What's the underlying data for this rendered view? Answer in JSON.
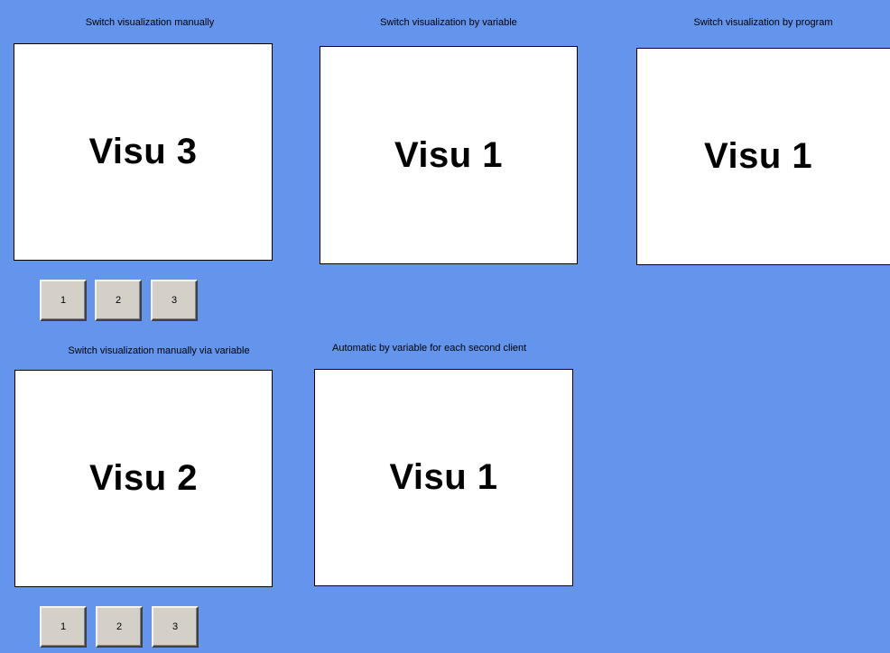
{
  "colors": {
    "background": "#6495ed",
    "frame": "#ffffff",
    "button": "#d4d0c8"
  },
  "panels": {
    "manual": {
      "caption": "Switch visualization manually",
      "content": "Visu 3",
      "buttons": [
        "1",
        "2",
        "3"
      ]
    },
    "by_variable": {
      "caption": "Switch visualization by variable",
      "content": "Visu 1"
    },
    "by_program": {
      "caption": "Switch  visualization by program",
      "content": "Visu 1"
    },
    "manual_via_variable": {
      "caption": "Switch  visualization manually via variable",
      "content": "Visu 2",
      "buttons": [
        "1",
        "2",
        "3"
      ]
    },
    "automatic_per_client": {
      "caption": "Automatic by variable for each second client",
      "content": "Visu 1"
    }
  }
}
